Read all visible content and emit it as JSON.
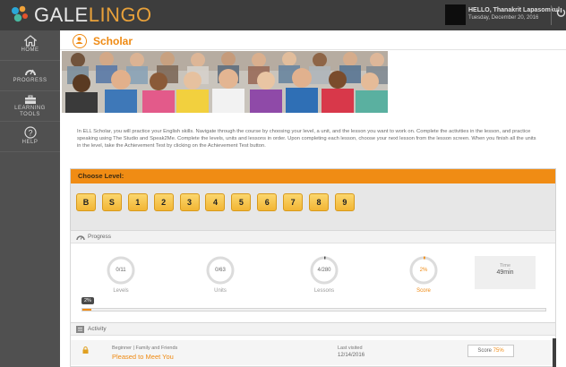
{
  "brand": {
    "part1": "GALE",
    "part2": "LINGO"
  },
  "user": {
    "greeting": "HELLO, Thanakrit Lapasomkul",
    "date": "Tuesday, December 20, 2016"
  },
  "sidebar": {
    "items": [
      {
        "label": "HOME",
        "icon": "home-icon"
      },
      {
        "label": "PROGRESS",
        "icon": "progress-gauge-icon"
      },
      {
        "label": "LEARNING TOOLS",
        "icon": "toolbox-icon"
      },
      {
        "label": "HELP",
        "icon": "help-icon"
      }
    ]
  },
  "page": {
    "title": "Scholar",
    "intro": "In ELL Scholar, you will practice your English skills. Navigate through the course by choosing your level, a unit, and the lesson you want to work on. Complete the activities in the lesson, and practice speaking using The Studio and Speak2Me. Complete the levels, units and lessons in order. Upon completing each lesson, choose your next lesson from the lesson screen. When you finish all the units in the level, take the Achievement Test by clicking on the Achievement Test button."
  },
  "level": {
    "heading": "Choose Level:",
    "buttons": [
      "B",
      "S",
      "1",
      "2",
      "3",
      "4",
      "5",
      "6",
      "7",
      "8",
      "9"
    ]
  },
  "progress": {
    "heading": "Progress",
    "stats": [
      {
        "value": "0/11",
        "label": "Levels",
        "fraction": 0
      },
      {
        "value": "0/63",
        "label": "Units",
        "fraction": 0
      },
      {
        "value": "4/280",
        "label": "Lessons",
        "fraction": 0.014
      },
      {
        "value": "2%",
        "label": "Score",
        "fraction": 0.02
      }
    ],
    "time_label": "Time",
    "time_value": "49min",
    "overall_percent": 2,
    "overall_label": "2%"
  },
  "activity": {
    "heading": "Activity",
    "rows": [
      {
        "category": "Beginner | Family and Friends",
        "name": "Pleased to Meet You",
        "visited_label": "Last visited",
        "visited_date": "12/14/2016",
        "score_label": "Score",
        "score_value": "75%"
      }
    ]
  },
  "colors": {
    "accent": "#f08c14",
    "sidebar": "#505050",
    "topbar": "#3d3d3d"
  }
}
